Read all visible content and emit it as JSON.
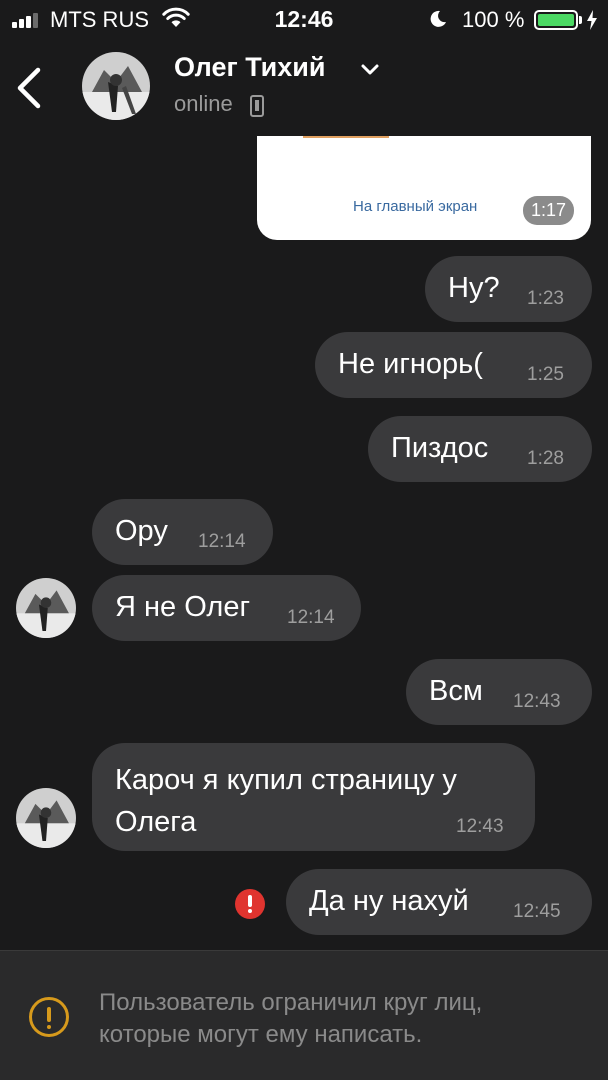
{
  "status_bar": {
    "carrier": "MTS RUS",
    "time": "12:46",
    "battery_percent": "100 %",
    "signal_bars_filled": 3,
    "signal_bars_total": 4,
    "battery_level": 1.0
  },
  "header": {
    "name": "Олег Тихий",
    "status": "online"
  },
  "card": {
    "link_text": "На главный экран",
    "time": "1:17"
  },
  "messages": [
    {
      "side": "out",
      "text": "Ну?",
      "time": "1:23"
    },
    {
      "side": "out",
      "text": "Не игнорь(",
      "time": "1:25"
    },
    {
      "side": "out",
      "text": "Пиздос",
      "time": "1:28"
    },
    {
      "side": "in",
      "text": "Ору",
      "time": "12:14"
    },
    {
      "side": "in",
      "text": "Я не Олег",
      "time": "12:14"
    },
    {
      "side": "out",
      "text": "Всм",
      "time": "12:43"
    },
    {
      "side": "in",
      "text": "Кароч я купил страницу у Олега",
      "time": "12:43"
    },
    {
      "side": "out",
      "text": "Да ну нахуй",
      "time": "12:45",
      "failed": true
    }
  ],
  "restriction": {
    "text": "Пользователь ограничил круг лиц, которые могут ему написать."
  },
  "colors": {
    "background": "#1a1a1b",
    "bubble": "#3a3a3c",
    "battery": "#4cd964",
    "error": "#e0342f",
    "warning": "#d79a1c"
  }
}
